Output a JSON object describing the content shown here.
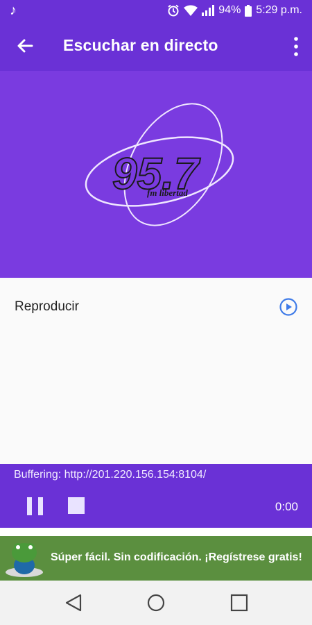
{
  "status_bar": {
    "battery": "94%",
    "time": "5:29 p.m.",
    "icons": [
      "music-note-icon",
      "alarm-icon",
      "wifi-icon",
      "signal-icon",
      "battery-icon"
    ]
  },
  "app_bar": {
    "title": "Escuchar en directo",
    "back_icon": "arrow-back-icon",
    "menu_icon": "more-vert-icon"
  },
  "hero": {
    "logo_number": "95.7",
    "logo_subtitle": "fm libertad",
    "background": "#7a3be0"
  },
  "list": {
    "play_label": "Reproducir",
    "play_icon": "play-circle-icon"
  },
  "player": {
    "status": "Buffering: http://201.220.156.154:8104/",
    "elapsed": "0:00",
    "pause_icon": "pause-icon",
    "stop_icon": "stop-icon"
  },
  "ad": {
    "text": "Súper fácil. Sin codificación. ¡Regístrese gratis!",
    "logo_icon": "frog-mascot-icon",
    "background": "#5b8f3f"
  },
  "nav_bar": {
    "back_icon": "nav-back-triangle-icon",
    "home_icon": "nav-home-circle-icon",
    "recents_icon": "nav-recents-square-icon"
  },
  "colors": {
    "primary": "#6a31d6",
    "accent_blue": "#3f7be8"
  }
}
